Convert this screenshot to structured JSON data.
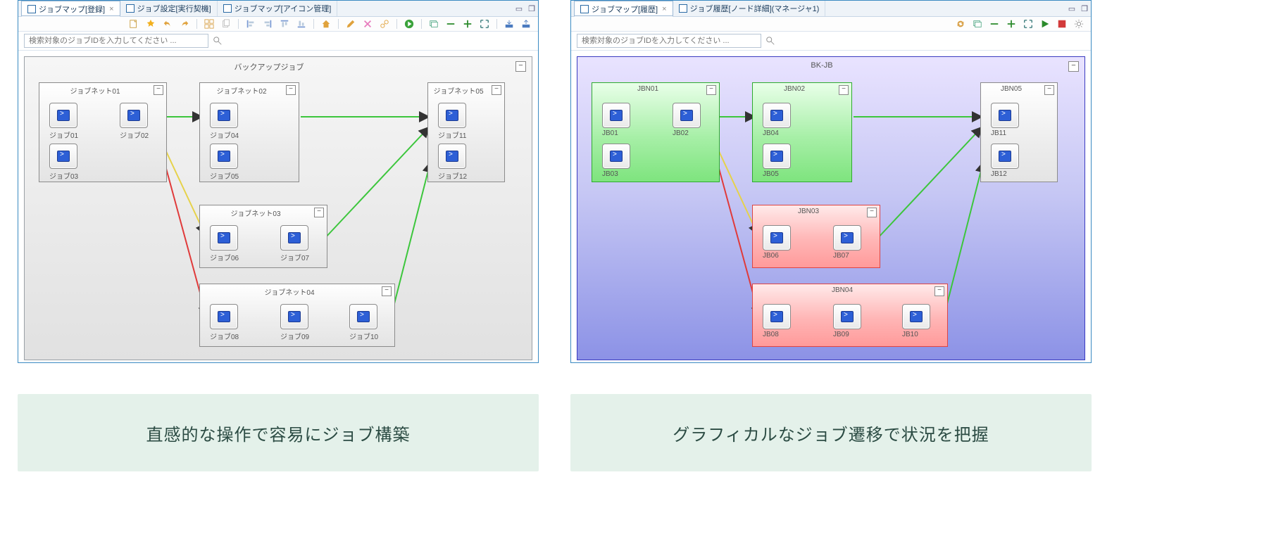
{
  "left": {
    "tabs": [
      {
        "label": "ジョブマップ[登録]",
        "active": true,
        "closable": true
      },
      {
        "label": "ジョブ設定[実行契機]",
        "active": false,
        "closable": false
      },
      {
        "label": "ジョブマップ[アイコン管理]",
        "active": false,
        "closable": false
      }
    ],
    "search_placeholder": "検索対象のジョブIDを入力してください ...",
    "canvas_title": "バックアップジョブ",
    "groups": {
      "n01": {
        "title": "ジョブネット01",
        "jobs": [
          "ジョブ01",
          "ジョブ02",
          "ジョブ03"
        ]
      },
      "n02": {
        "title": "ジョブネット02",
        "jobs": [
          "ジョブ04",
          "ジョブ05"
        ]
      },
      "n03": {
        "title": "ジョブネット03",
        "jobs": [
          "ジョブ06",
          "ジョブ07"
        ]
      },
      "n04": {
        "title": "ジョブネット04",
        "jobs": [
          "ジョブ08",
          "ジョブ09",
          "ジョブ10"
        ]
      },
      "n05": {
        "title": "ジョブネット05",
        "jobs": [
          "ジョブ11",
          "ジョブ12"
        ]
      }
    },
    "caption": "直感的な操作で容易にジョブ構築",
    "toolbar": [
      "new",
      "star",
      "undo",
      "redo",
      "grid",
      "copy",
      "paste",
      "align-l",
      "align-r",
      "align-t",
      "align-b",
      "home",
      "pencil",
      "x-red",
      "link",
      "play",
      "layers",
      "minus",
      "plus",
      "fit",
      "import",
      "export"
    ]
  },
  "right": {
    "tabs": [
      {
        "label": "ジョブマップ[履歴]",
        "active": true,
        "closable": true
      },
      {
        "label": "ジョブ履歴[ノード詳細](マネージャ1)",
        "active": false,
        "closable": false
      }
    ],
    "search_placeholder": "検索対象のジョブIDを入力してください ...",
    "canvas_title": "BK-JB",
    "groups": {
      "n01": {
        "title": "JBN01",
        "jobs": [
          "JB01",
          "JB02",
          "JB03"
        ]
      },
      "n02": {
        "title": "JBN02",
        "jobs": [
          "JB04",
          "JB05"
        ]
      },
      "n03": {
        "title": "JBN03",
        "jobs": [
          "JB06",
          "JB07"
        ]
      },
      "n04": {
        "title": "JBN04",
        "jobs": [
          "JB08",
          "JB09",
          "JB10"
        ]
      },
      "n05": {
        "title": "JBN05",
        "jobs": [
          "JB11",
          "JB12"
        ]
      }
    },
    "caption": "グラフィカルなジョブ遷移で状況を把握",
    "toolbar": [
      "refresh",
      "layers",
      "minus",
      "plus",
      "fit",
      "play-green",
      "stop-red",
      "gear"
    ],
    "status_colors": {
      "n01": "green",
      "n02": "green",
      "n03": "red",
      "n04": "red",
      "n05": "grey"
    }
  },
  "collapse_glyph": "−"
}
